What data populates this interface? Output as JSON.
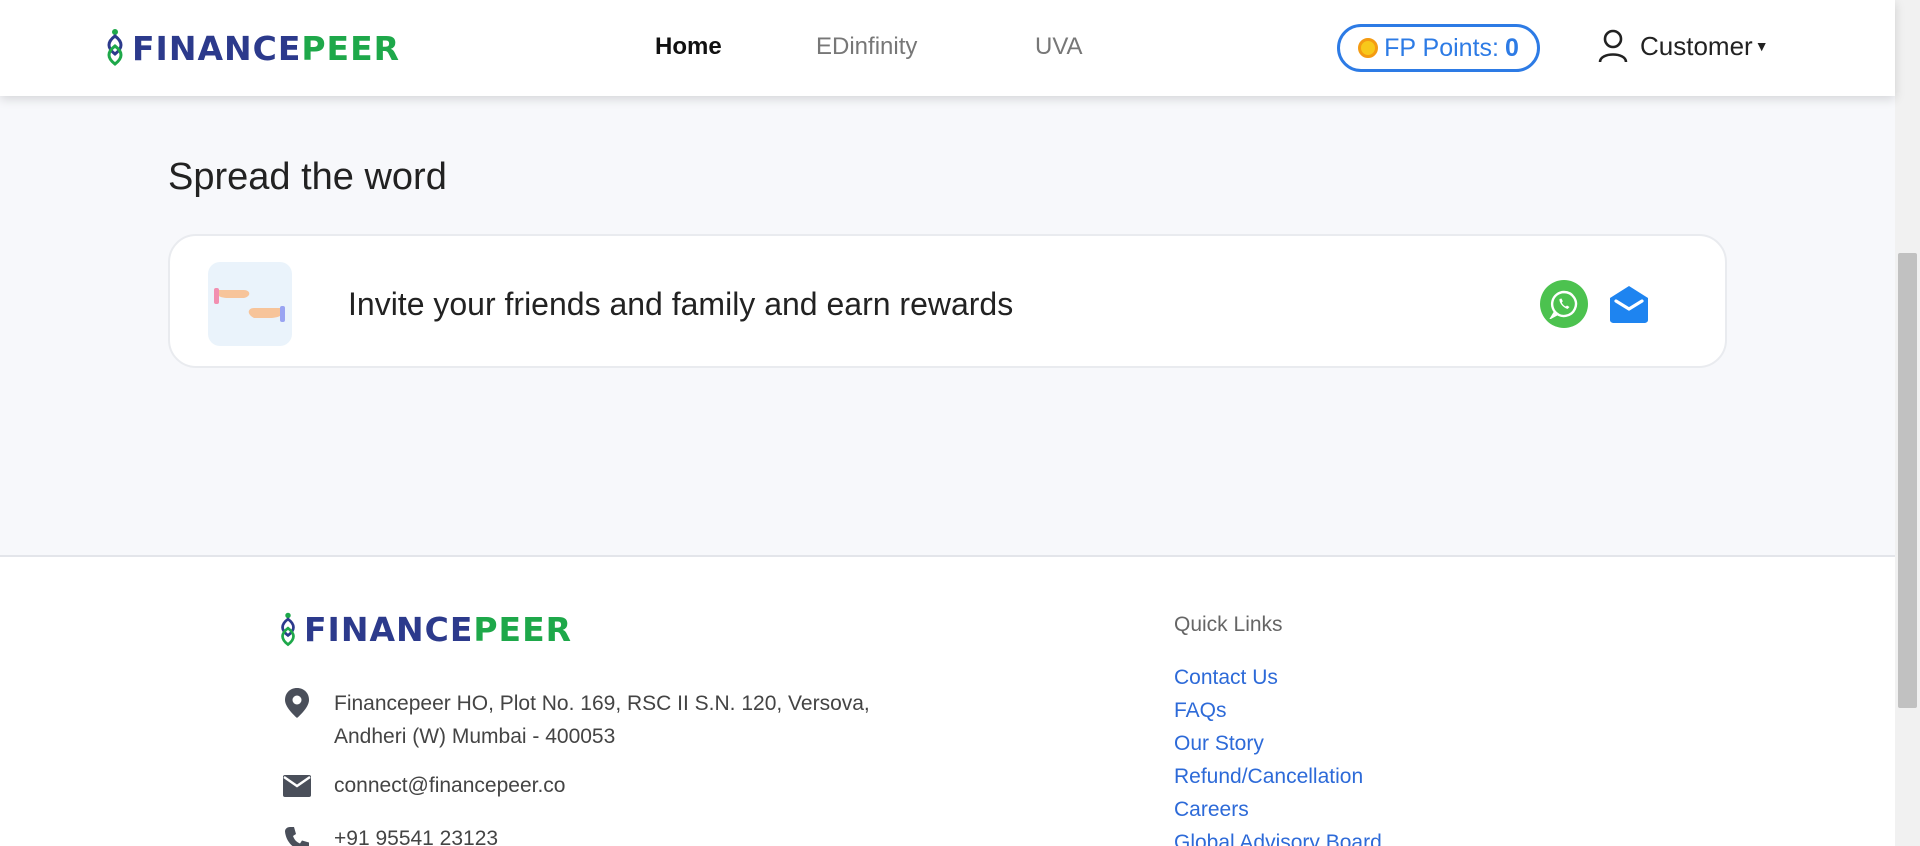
{
  "brand": {
    "word1": "FINANCE",
    "word2": "PEER"
  },
  "nav": {
    "home": "Home",
    "edinfinity": "EDinfinity",
    "uva": "UVA"
  },
  "points": {
    "label": "FP Points:",
    "value": "0"
  },
  "user": {
    "name": "Customer"
  },
  "spread": {
    "title": "Spread the word",
    "invite_text": "Invite your friends and family and earn rewards"
  },
  "footer": {
    "address_line1": "Financepeer HO, Plot No. 169, RSC II S.N. 120, Versova,",
    "address_line2": "Andheri (W) Mumbai - 400053",
    "email": "connect@financepeer.co",
    "phone": "+91 95541 23123",
    "quick_links_title": "Quick Links",
    "quick_links": [
      "Contact Us",
      "FAQs",
      "Our Story",
      "Refund/Cancellation",
      "Careers",
      "Global Advisory Board"
    ]
  },
  "colors": {
    "brand_blue": "#2c3a8c",
    "brand_green": "#1ea84a",
    "accent_blue": "#2d7be5",
    "link_blue": "#2d6ad8",
    "whatsapp_green": "#4cc24f"
  },
  "icons": [
    "logo-mark-icon",
    "coin-icon",
    "user-icon",
    "caret-down-icon",
    "hands-icon",
    "whatsapp-icon",
    "mail-icon",
    "location-pin-icon",
    "envelope-icon",
    "phone-icon"
  ]
}
